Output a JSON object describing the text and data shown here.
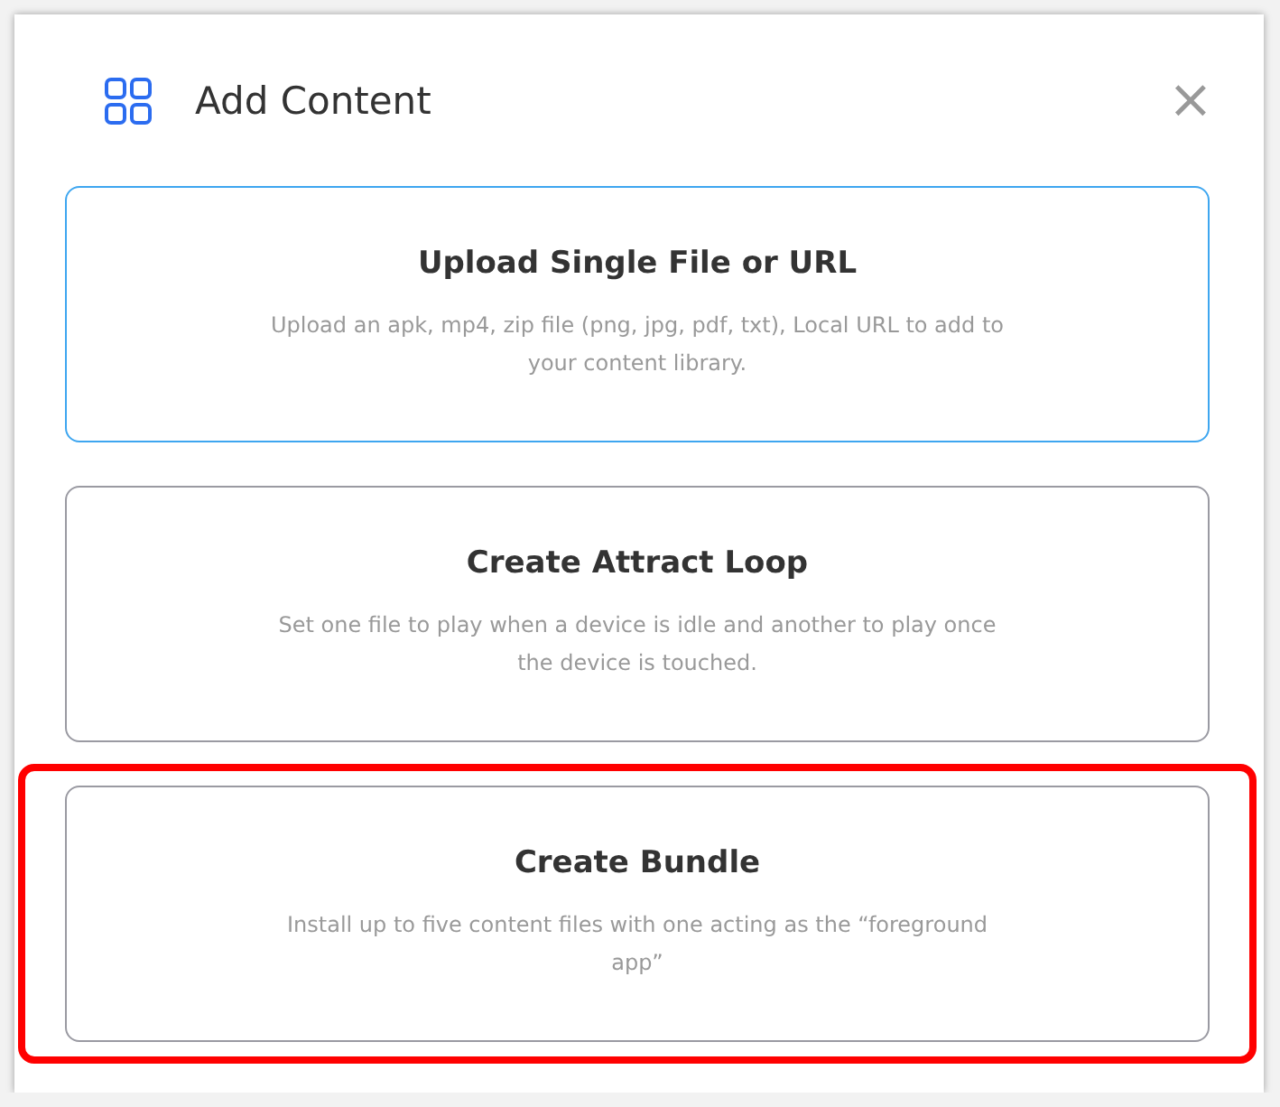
{
  "dialog": {
    "title": "Add Content",
    "close": "×"
  },
  "options": [
    {
      "title": "Upload Single File or URL",
      "description": "Upload an apk, mp4, zip file (png, jpg, pdf, txt), Local URL to add to your content library.",
      "selected": true,
      "highlighted": false
    },
    {
      "title": "Create Attract Loop",
      "description": "Set one file to play when a device is idle and another to play once the device is touched.",
      "selected": false,
      "highlighted": false
    },
    {
      "title": "Create Bundle",
      "description": "Install up to five content files with one acting as the “foreground app”",
      "selected": false,
      "highlighted": true
    }
  ]
}
